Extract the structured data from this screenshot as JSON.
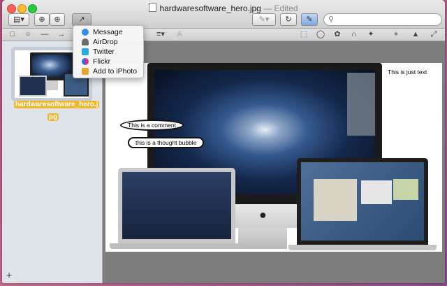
{
  "window": {
    "filename": "hardwaresoftware_hero.jpg",
    "edited": "— Edited"
  },
  "toolbar": {
    "search_placeholder": ""
  },
  "share_menu": {
    "items": [
      {
        "label": "Message",
        "icon": "message-icon",
        "color": "#2e8fea"
      },
      {
        "label": "AirDrop",
        "icon": "airdrop-icon",
        "color": "#6b6b6b"
      },
      {
        "label": "Twitter",
        "icon": "twitter-icon",
        "color": "#2aa7e6"
      },
      {
        "label": "Flickr",
        "icon": "flickr-icon",
        "color": "#e02c84"
      },
      {
        "label": "Add to iPhoto",
        "icon": "iphoto-icon",
        "color": "#e7a52c"
      }
    ]
  },
  "sidebar": {
    "thumbnail_name_line1": "hardwaresoftware_hero.j",
    "thumbnail_name_line2": "pg",
    "add_button": "+"
  },
  "document": {
    "annotation_right": "This is just text",
    "comment_1": "This is a comment",
    "comment_2": "this is a thought bubble"
  },
  "colors": {
    "selection": "#f0b72a",
    "accent_blue": "#3d7be6"
  }
}
